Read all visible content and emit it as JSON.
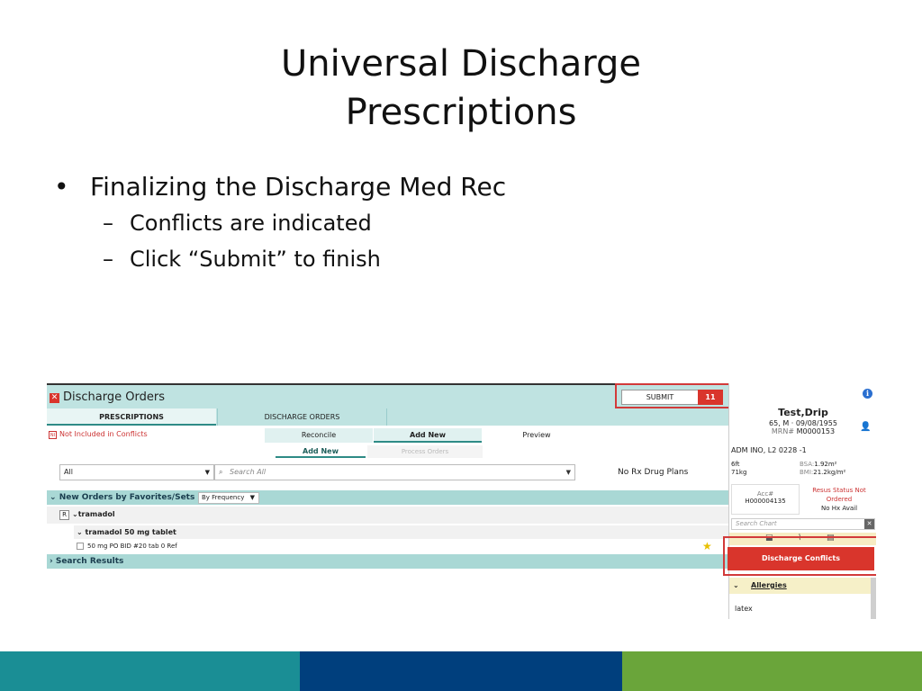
{
  "slide": {
    "title_line1": "Universal Discharge",
    "title_line2": "Prescriptions",
    "bullet_main": "Finalizing the Discharge Med Rec",
    "sub_bullets": [
      "Conflicts are indicated",
      "Click “Submit” to finish"
    ],
    "bullet_glyph": "•",
    "dash_glyph": "–"
  },
  "screenshot": {
    "header": {
      "close_icon": "x-icon",
      "title": "Discharge Orders"
    },
    "submit": {
      "label": "SUBMIT",
      "count": "11"
    },
    "tabs": [
      "PRESCRIPTIONS",
      "DISCHARGE ORDERS"
    ],
    "not_included": {
      "icon": "NI",
      "label": "Not Included in Conflicts"
    },
    "subtabs": [
      "Reconcile",
      "Add New",
      "Preview"
    ],
    "subtabs2": [
      "Add New",
      "Process Orders"
    ],
    "filter_select": "All",
    "search_placeholder": "Search All",
    "no_rx": "No Rx Drug Plans",
    "favorites_band": "New Orders by Favorites/Sets",
    "freq_select": "By Frequency",
    "rx_icon": "R",
    "tramadol_group": "tramadol",
    "tramadol_tablet": "tramadol 50 mg tablet",
    "order_option": "50 mg PO BID #20 tab 0 Ref",
    "search_results": "Search Results"
  },
  "patient": {
    "name": "Test,Drip",
    "demo": "65, M · 09/08/1955",
    "mrn_label": "MRN#",
    "mrn": "M0000153",
    "adm": "ADM INO, L2  0228 -1",
    "height": "6ft",
    "weight": "71kg",
    "bsa_label": "BSA:",
    "bsa": "1.92m²",
    "bmi_label": "BMI:",
    "bmi": "21.2kg/m²",
    "acc_label": "Acc#",
    "acc": "H000004135",
    "resus": "Resus Status Not Ordered",
    "nohx": "No Hx Avail",
    "search_chart": "Search Chart",
    "discharge_conflicts": "Discharge Conflicts",
    "allergies": "Allergies",
    "allergy_item": "latex"
  },
  "colors": {
    "teal_band": "#1a8e95",
    "navy_band": "#003f7d",
    "green_band": "#6aa53a",
    "highlight_red": "#d23a3a"
  }
}
